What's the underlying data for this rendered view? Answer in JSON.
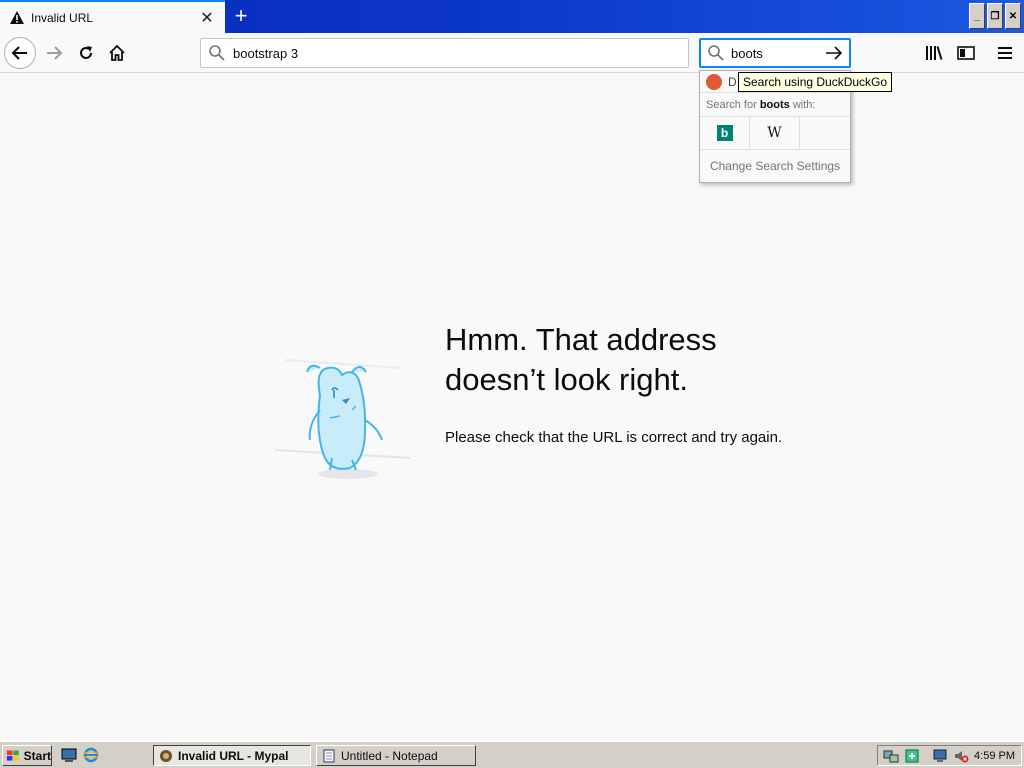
{
  "tab": {
    "title": "Invalid URL",
    "close": "✕",
    "new": "+"
  },
  "window": {
    "minimize": "_",
    "restore": "❐",
    "close": "✕"
  },
  "urlbar": {
    "value": "bootstrap 3"
  },
  "searchbar": {
    "value": "boots"
  },
  "search_popup": {
    "engine_short": "D",
    "search_for_prefix": "Search for ",
    "search_term": "boots",
    "search_for_suffix": " with:",
    "bing_glyph": "b",
    "wiki_glyph": "W",
    "change_settings": "Change Search Settings"
  },
  "tooltip": "Search using DuckDuckGo",
  "error": {
    "title_line1": "Hmm. That address",
    "title_line2": "doesn’t look right.",
    "message": "Please check that the URL is correct and try again."
  },
  "taskbar": {
    "start": "Start",
    "tasks": [
      {
        "label": "Invalid URL - Mypal"
      },
      {
        "label": "Untitled - Notepad"
      }
    ],
    "clock": "4:59 PM"
  },
  "colors": {
    "accent": "#0a84ff",
    "titlebar": "#0a36c8",
    "ddg": "#de5833",
    "bing": "#008373"
  }
}
